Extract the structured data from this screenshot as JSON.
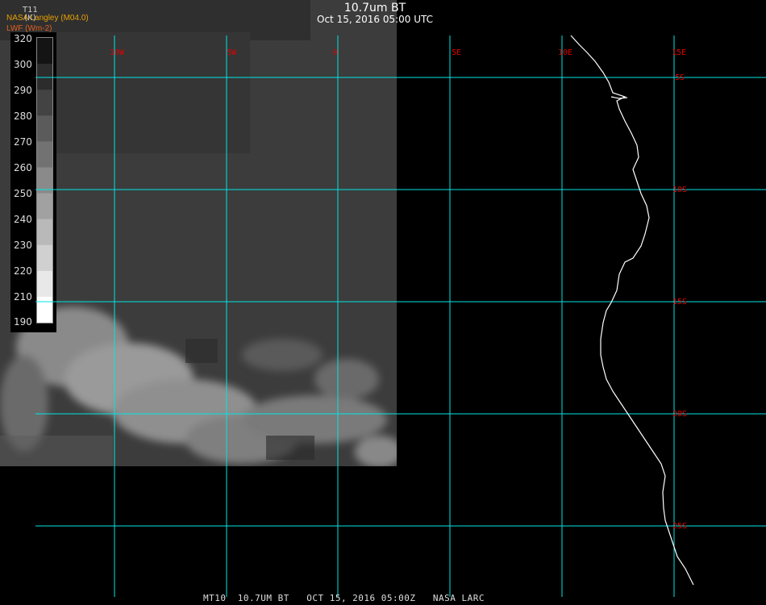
{
  "title": "10.7um BT",
  "subtitle": "Oct 15, 2016 05:00 UTC",
  "credit_line1": "NASA Langley (M04.0)",
  "credit_line2": "LWF (Wm-2)",
  "colorbar": {
    "label_line1": "T11",
    "label_line2": "(K)",
    "ticks": [
      "320",
      "300",
      "290",
      "280",
      "270",
      "260",
      "250",
      "240",
      "230",
      "220",
      "210",
      "190"
    ]
  },
  "grid": {
    "lon_labels": [
      "10W",
      "5W",
      "0",
      "5E",
      "10E",
      "15E"
    ],
    "lat_labels": [
      "5S",
      "10S",
      "15S",
      "20S",
      "25S"
    ],
    "grid_color": "#00e5e5",
    "label_color": "#e00000"
  },
  "footer": "MT10  10.7UM BT   OCT 15, 2016 05:00Z   NASA LARC",
  "colors": {
    "background": "#000000",
    "cloud_field": "#3c3c3c",
    "coastline": "#ffffff"
  }
}
